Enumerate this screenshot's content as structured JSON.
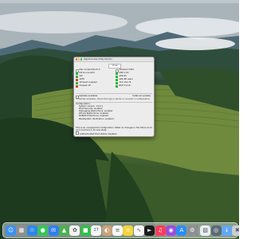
{
  "window": {
    "title": "Objective-See Utility Monitor",
    "close_label": "Close",
    "status_left": [
      {
        "label": "Mac model Mac15,3",
        "color": "none"
      },
      {
        "label": "M3 8-core GPU",
        "color": "#27b033"
      },
      {
        "label": "SIP",
        "color": "#27b033"
      },
      {
        "label": "APFS",
        "color": "#d93a2e"
      },
      {
        "label": "XProtect enabled",
        "color": "#27b033"
      },
      {
        "label": "Firewall off",
        "color": "#d93a2e"
      }
    ],
    "status_right": [
      {
        "label": "XProtect 5303",
        "color": "none"
      },
      {
        "label": "MRT 1.93",
        "color": "#27b033"
      },
      {
        "label": "XPR 95",
        "color": "#27b033"
      },
      {
        "label": "GPK 88 users",
        "color": "#27b033"
      },
      {
        "label": "TCC 151.75",
        "color": "#27b033"
      },
      {
        "label": "BSIT 10.16",
        "color": "#27b033"
      }
    ],
    "updates_label": "Updates available",
    "install_label": "Install all updates",
    "update_note": "→ Update available. Check the logs in Alerts or consider a configuration.",
    "config_header": "Configuration:",
    "config_items": [
      "System version: 14.2.1",
      "Boot Security: enabled",
      "Debugging Restrictions: enabled",
      "DTrace Restrictions: enabled",
      "NVRAM Protections: enabled",
      "BaseSystem Verification: enabled"
    ],
    "footer_lines": [
      "This is an unsupported configuration. Make no changes in the future and leave",
      "your machine in its sole state."
    ],
    "footer_checkbox_label": "Authenticated Root status: disabled"
  },
  "dock": {
    "apps": [
      {
        "name": "finder-icon",
        "color": "#3d8ef0",
        "glyph": "☺"
      },
      {
        "name": "launchpad-icon",
        "color": "#8e8e93",
        "glyph": "▦"
      },
      {
        "name": "safari-icon",
        "color": "#2f86e8",
        "glyph": "☉"
      },
      {
        "name": "messages-icon",
        "color": "#34c759",
        "glyph": "●"
      },
      {
        "name": "mail-icon",
        "color": "#2f7ff0",
        "glyph": "✉"
      },
      {
        "name": "maps-icon",
        "color": "#4cb050",
        "glyph": "▲"
      },
      {
        "name": "photos-icon",
        "color": "#f2f2f2",
        "glyph": "✿"
      },
      {
        "name": "facetime-icon",
        "color": "#30c04a",
        "glyph": "■"
      },
      {
        "name": "calendar-icon",
        "color": "#f5f5f5",
        "glyph": "27"
      },
      {
        "name": "contacts-icon",
        "color": "#c9a27a",
        "glyph": "◐"
      },
      {
        "name": "reminders-icon",
        "color": "#f7f7f7",
        "glyph": "≡"
      },
      {
        "name": "notes-icon",
        "color": "#f7d33b",
        "glyph": "≡"
      },
      {
        "name": "freeform-icon",
        "color": "#f7f7f7",
        "glyph": "∿"
      },
      {
        "name": "tv-icon",
        "color": "#1c1c1e",
        "glyph": "►"
      },
      {
        "name": "music-icon",
        "color": "#fa3c5a",
        "glyph": "♫"
      },
      {
        "name": "podcasts-icon",
        "color": "#9a4fd8",
        "glyph": "◉"
      },
      {
        "name": "app-store-icon",
        "color": "#2b8ef2",
        "glyph": "A"
      },
      {
        "name": "system-settings-icon",
        "color": "#8e8e93",
        "glyph": "⚙"
      },
      {
        "name": "preview-icon",
        "color": "#e9eef3",
        "glyph": "▧"
      },
      {
        "name": "utility-app-icon",
        "color": "#5b6b75",
        "glyph": "◎"
      },
      {
        "name": "downloads-folder-icon",
        "color": "#62a8f5",
        "glyph": "↓"
      },
      {
        "name": "trash-icon",
        "color": "#c9ced3",
        "glyph": "✖"
      }
    ]
  }
}
